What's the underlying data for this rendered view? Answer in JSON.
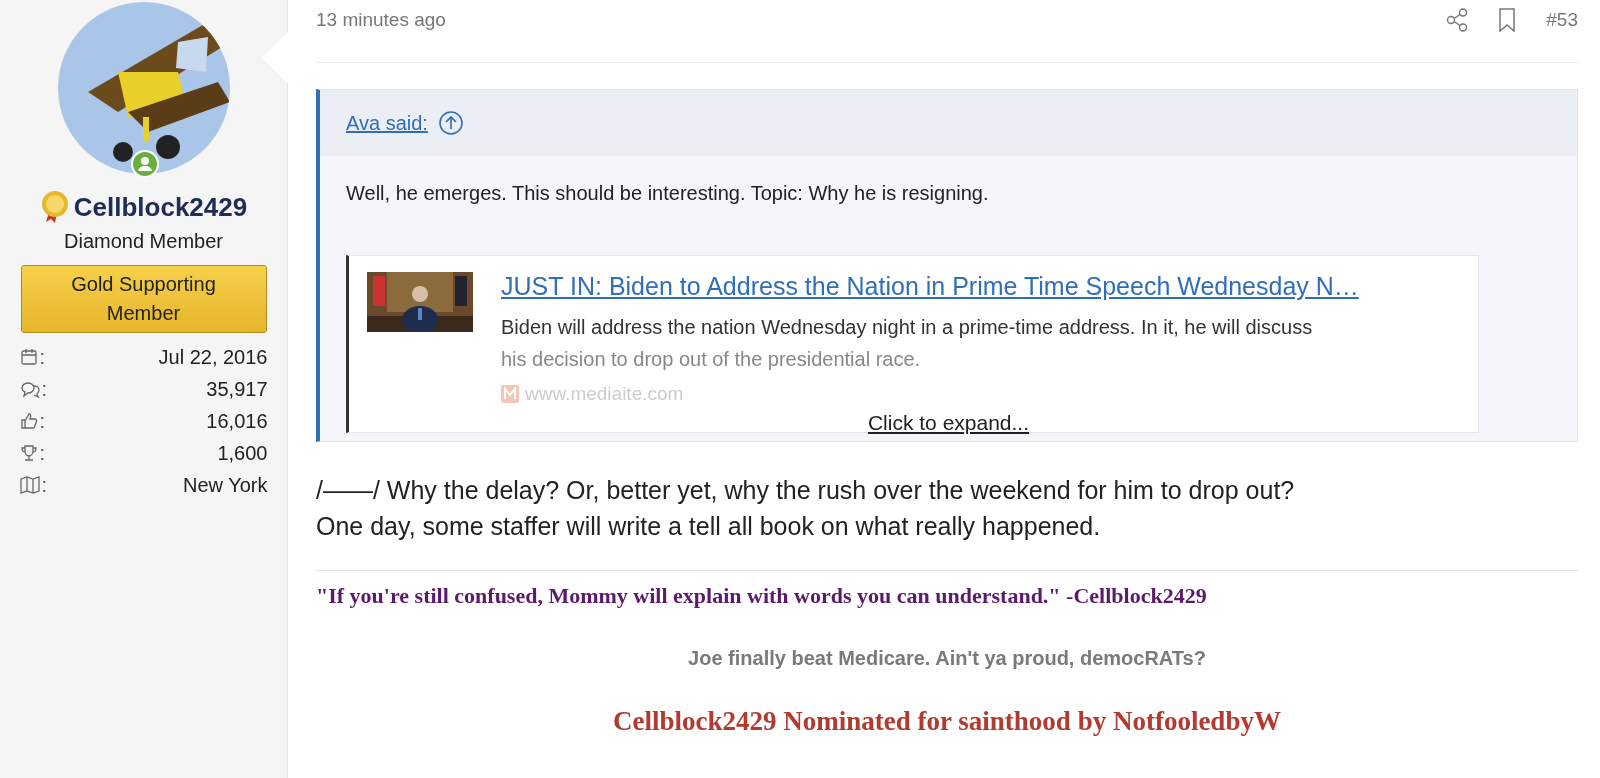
{
  "user": {
    "name": "Cellblock2429",
    "title": "Diamond Member",
    "banner": "Gold Supporting Member",
    "online": true,
    "separator": ":",
    "stats": [
      {
        "kind": "calendar",
        "value": "Jul 22, 2016"
      },
      {
        "kind": "messages",
        "value": "35,917"
      },
      {
        "kind": "likes",
        "value": "16,016"
      },
      {
        "kind": "trophy",
        "value": "1,600"
      },
      {
        "kind": "location",
        "value": "New York"
      }
    ]
  },
  "post": {
    "time": "13 minutes ago",
    "number": "#53",
    "quote": {
      "author": "Ava said:",
      "text": "Well, he emerges. This should be interesting. Topic: Why he is resigning.",
      "embed": {
        "title": "JUST IN: Biden to Address the Nation in Prime Time Speech Wednesday N…",
        "summary": "Biden will address the nation Wednesday night in a prime-time address. In it, he will discuss",
        "summary_faded": "his decision to drop out of the presidential race.",
        "site": "www.mediaite.com"
      },
      "expand": "Click to expand..."
    },
    "body": [
      "/——/ Why the delay? Or, better yet, why the rush over the weekend for him to drop out?",
      "One day, some staffer will write a tell all book on what really happened."
    ],
    "signature": [
      {
        "kind": "quote",
        "color": "#5c1a6b",
        "text": "\"If you're still confused, Mommy will explain with words you can understand.\" -Cellblock2429"
      },
      {
        "kind": "note",
        "color": "#7a7a7a",
        "text": "Joe finally beat Medicare. Ain't ya proud, democRATs?"
      },
      {
        "kind": "banner",
        "color": "#b23a2e",
        "text": "Cellblock2429 Nominated for sainthood by NotfooledbyW"
      }
    ]
  }
}
